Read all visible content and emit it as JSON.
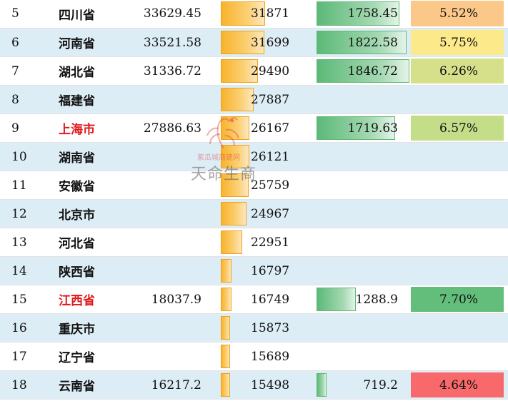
{
  "colors": {
    "shade_row": "#ddedf6",
    "bar_2022": "#f8b32c",
    "bar_increase": "#5cb978",
    "red_text": "#e0191c"
  },
  "watermark": {
    "brand": "天命生商",
    "small": "紫瓜城商建网",
    "icon": "phoenix-logo-icon"
  },
  "rows": [
    {
      "rank": "5",
      "province": "四川省",
      "red": false,
      "v2023": "33629.45",
      "v2022": "31871",
      "v2022_num": 31871,
      "increase": "1758.45",
      "increase_num": 1758.45,
      "rate": "5.52%",
      "rate_color": "#fcc88a"
    },
    {
      "rank": "6",
      "province": "河南省",
      "red": false,
      "v2023": "33521.58",
      "v2022": "31699",
      "v2022_num": 31699,
      "increase": "1822.58",
      "increase_num": 1822.58,
      "rate": "5.75%",
      "rate_color": "#fce98a"
    },
    {
      "rank": "7",
      "province": "湖北省",
      "red": false,
      "v2023": "31336.72",
      "v2022": "29490",
      "v2022_num": 29490,
      "increase": "1846.72",
      "increase_num": 1846.72,
      "rate": "6.26%",
      "rate_color": "#d6e08a"
    },
    {
      "rank": "8",
      "province": "福建省",
      "red": false,
      "v2023": "",
      "v2022": "27887",
      "v2022_num": 27887,
      "increase": "",
      "increase_num": 0,
      "rate": "",
      "rate_color": ""
    },
    {
      "rank": "9",
      "province": "上海市",
      "red": true,
      "v2023": "27886.63",
      "v2022": "26167",
      "v2022_num": 26167,
      "increase": "1719.63",
      "increase_num": 1719.63,
      "rate": "6.57%",
      "rate_color": "#c4dd88"
    },
    {
      "rank": "10",
      "province": "湖南省",
      "red": false,
      "v2023": "",
      "v2022": "26121",
      "v2022_num": 26121,
      "increase": "",
      "increase_num": 0,
      "rate": "",
      "rate_color": ""
    },
    {
      "rank": "11",
      "province": "安徽省",
      "red": false,
      "v2023": "",
      "v2022": "25759",
      "v2022_num": 25759,
      "increase": "",
      "increase_num": 0,
      "rate": "",
      "rate_color": ""
    },
    {
      "rank": "12",
      "province": "北京市",
      "red": false,
      "v2023": "",
      "v2022": "24967",
      "v2022_num": 24967,
      "increase": "",
      "increase_num": 0,
      "rate": "",
      "rate_color": ""
    },
    {
      "rank": "13",
      "province": "河北省",
      "red": false,
      "v2023": "",
      "v2022": "22951",
      "v2022_num": 22951,
      "increase": "",
      "increase_num": 0,
      "rate": "",
      "rate_color": ""
    },
    {
      "rank": "14",
      "province": "陕西省",
      "red": false,
      "v2023": "",
      "v2022": "16797",
      "v2022_num": 16797,
      "increase": "",
      "increase_num": 0,
      "rate": "",
      "rate_color": ""
    },
    {
      "rank": "15",
      "province": "江西省",
      "red": true,
      "v2023": "18037.9",
      "v2022": "16749",
      "v2022_num": 16749,
      "increase": "1288.9",
      "increase_num": 1288.9,
      "rate": "7.70%",
      "rate_color": "#63be7b"
    },
    {
      "rank": "16",
      "province": "重庆市",
      "red": false,
      "v2023": "",
      "v2022": "15873",
      "v2022_num": 15873,
      "increase": "",
      "increase_num": 0,
      "rate": "",
      "rate_color": ""
    },
    {
      "rank": "17",
      "province": "辽宁省",
      "red": false,
      "v2023": "",
      "v2022": "15689",
      "v2022_num": 15689,
      "increase": "",
      "increase_num": 0,
      "rate": "",
      "rate_color": ""
    },
    {
      "rank": "18",
      "province": "云南省",
      "red": false,
      "v2023": "16217.2",
      "v2022": "15498",
      "v2022_num": 15498,
      "increase": "719.2",
      "increase_num": 719.2,
      "rate": "4.64%",
      "rate_color": "#f8696b"
    }
  ]
}
